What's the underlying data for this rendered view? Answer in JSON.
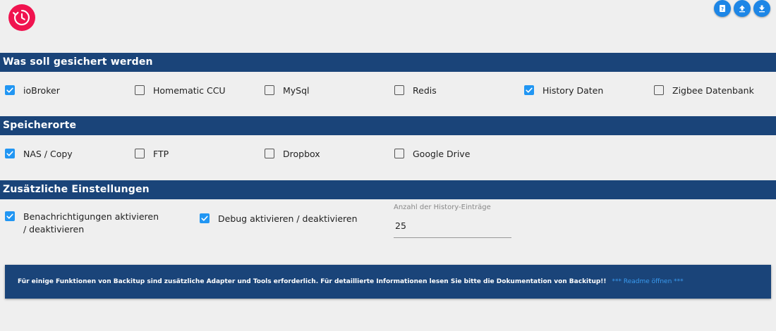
{
  "app": {
    "logo_icon": "clock-restore-icon",
    "brand_color": "#f0134f",
    "header_color": "#1a4479",
    "accent_color": "#2196f3"
  },
  "toolbar": {
    "buttons": [
      {
        "icon": "help-book-icon"
      },
      {
        "icon": "upload-icon"
      },
      {
        "icon": "download-icon"
      }
    ]
  },
  "sections": {
    "backup": {
      "title": "Was soll gesichert werden",
      "items": [
        {
          "label": "ioBroker",
          "checked": true
        },
        {
          "label": "Homematic CCU",
          "checked": false
        },
        {
          "label": "MySql",
          "checked": false
        },
        {
          "label": "Redis",
          "checked": false
        },
        {
          "label": "History Daten",
          "checked": true
        },
        {
          "label": "Zigbee Datenbank",
          "checked": false
        }
      ]
    },
    "storage": {
      "title": "Speicherorte",
      "items": [
        {
          "label": "NAS / Copy",
          "checked": true
        },
        {
          "label": "FTP",
          "checked": false
        },
        {
          "label": "Dropbox",
          "checked": false
        },
        {
          "label": "Google Drive",
          "checked": false
        }
      ]
    },
    "extra": {
      "title": "Zusätzliche Einstellungen",
      "items": [
        {
          "label": "Benachrichtigungen aktivieren / deaktivieren",
          "checked": true
        },
        {
          "label": "Debug aktivieren / deaktivieren",
          "checked": true
        }
      ],
      "history_entries": {
        "label": "Anzahl der History-Einträge",
        "value": "25"
      }
    }
  },
  "info": {
    "text": "Für einige Funktionen von Backitup sind zusätzliche Adapter und Tools erforderlich. Für detaillierte Informationen lesen Sie bitte die Dokumentation von Backitup!!",
    "link_label": "*** Readme öffnen ***"
  }
}
